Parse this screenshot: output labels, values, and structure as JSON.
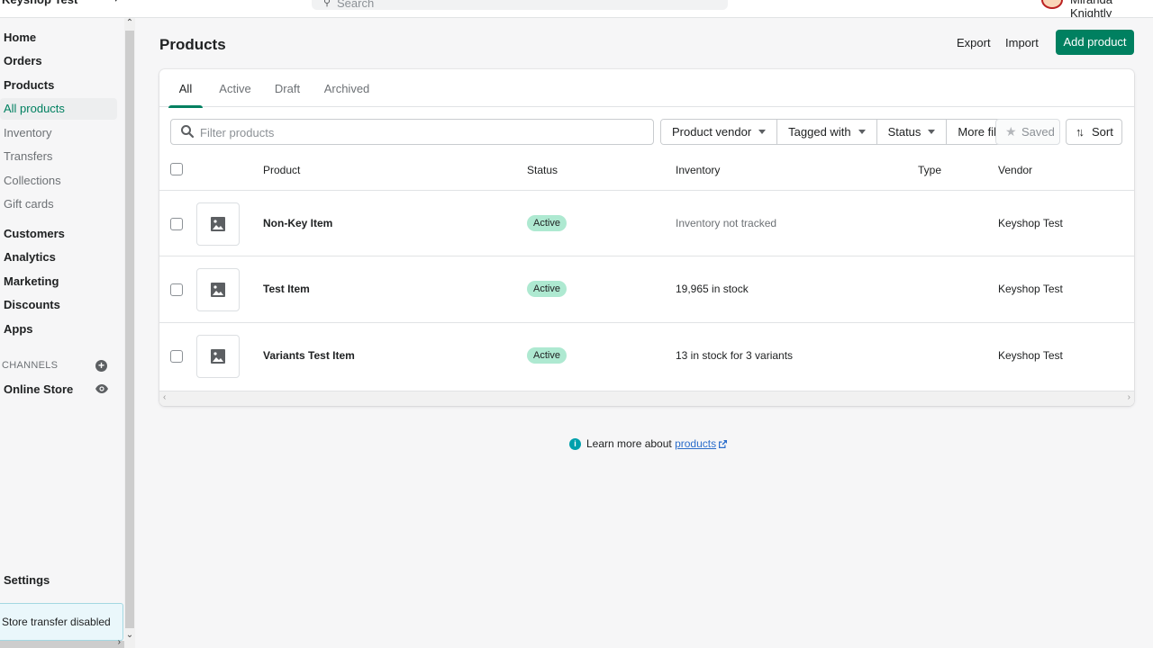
{
  "topbar": {
    "store_name": "Keyshop Test",
    "search_placeholder": "Search",
    "user_name": "Miranda Knightly"
  },
  "sidebar": {
    "items": [
      {
        "label": "Home",
        "type": "main"
      },
      {
        "label": "Orders",
        "type": "main"
      },
      {
        "label": "Products",
        "type": "main"
      },
      {
        "label": "All products",
        "type": "sub",
        "selected": true
      },
      {
        "label": "Inventory",
        "type": "sub"
      },
      {
        "label": "Transfers",
        "type": "sub"
      },
      {
        "label": "Collections",
        "type": "sub"
      },
      {
        "label": "Gift cards",
        "type": "sub"
      },
      {
        "label": "Customers",
        "type": "main"
      },
      {
        "label": "Analytics",
        "type": "main"
      },
      {
        "label": "Marketing",
        "type": "main"
      },
      {
        "label": "Discounts",
        "type": "main"
      },
      {
        "label": "Apps",
        "type": "main"
      }
    ],
    "channels_label": "CHANNELS",
    "online_store_label": "Online Store",
    "settings_label": "Settings",
    "transfer_banner": "Store transfer disabled"
  },
  "page": {
    "title": "Products",
    "export_label": "Export",
    "import_label": "Import",
    "add_product_label": "Add product"
  },
  "tabs": [
    {
      "label": "All",
      "active": true
    },
    {
      "label": "Active"
    },
    {
      "label": "Draft"
    },
    {
      "label": "Archived"
    }
  ],
  "filters": {
    "search_placeholder": "Filter products",
    "search_value": "",
    "product_vendor": "Product vendor",
    "tagged_with": "Tagged with",
    "status": "Status",
    "more_filters": "More filters",
    "saved": "Saved",
    "sort": "Sort"
  },
  "table": {
    "columns": [
      "Product",
      "Status",
      "Inventory",
      "Type",
      "Vendor"
    ],
    "rows": [
      {
        "product": "Non-Key Item",
        "status": "Active",
        "inventory": "Inventory not tracked",
        "inventory_muted": true,
        "type": "",
        "vendor": "Keyshop Test"
      },
      {
        "product": "Test Item",
        "status": "Active",
        "inventory": "19,965 in stock",
        "type": "",
        "vendor": "Keyshop Test"
      },
      {
        "product": "Variants Test Item",
        "status": "Active",
        "inventory": "13 in stock for 3 variants",
        "type": "",
        "vendor": "Keyshop Test"
      }
    ]
  },
  "footer": {
    "learn_more_text": "Learn more about ",
    "learn_more_link": "products"
  },
  "colors": {
    "primary": "#008060",
    "badge_active": "#aee9d1",
    "info": "#00a0ac",
    "link": "#2c6ecb"
  }
}
